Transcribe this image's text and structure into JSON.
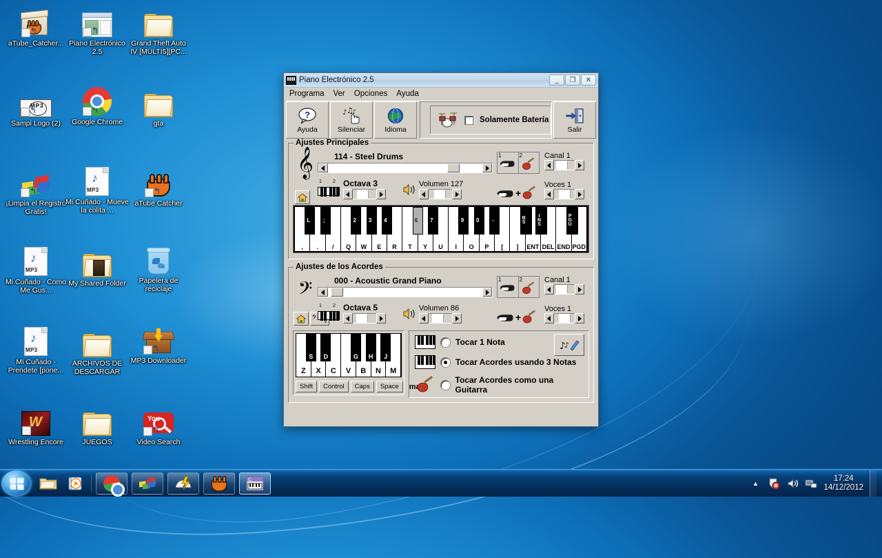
{
  "desktop": {
    "icons": [
      {
        "label": "aTube_Catcher...",
        "type": "installer",
        "shortcut": true
      },
      {
        "label": "Piano Electrónico 2.5",
        "type": "window",
        "shortcut": true
      },
      {
        "label": "Grand Theft Auto IV [MULTI5][PC...",
        "type": "folder",
        "shortcut": false
      },
      {
        "label": "Sampi Logo (2)",
        "type": "sampi",
        "shortcut": true
      },
      {
        "label": "Google Chrome",
        "type": "chrome",
        "shortcut": true
      },
      {
        "label": "gta",
        "type": "folder",
        "shortcut": false
      },
      {
        "label": "¡Limpia el Registro Gratis!",
        "type": "flags",
        "shortcut": true
      },
      {
        "label": "Mi Cuñado - Mueve la colita ...",
        "type": "mp3",
        "shortcut": false
      },
      {
        "label": "aTube Catcher",
        "type": "mitt",
        "shortcut": true
      },
      {
        "label": "Mi Cuñado - Como Me Gus...",
        "type": "mp3",
        "shortcut": false
      },
      {
        "label": "My Shared Folder",
        "type": "sharedfolder",
        "shortcut": false
      },
      {
        "label": "Papelera de reciclaje",
        "type": "bin",
        "shortcut": false
      },
      {
        "label": "Mi Cuñado - Prendete [pone...",
        "type": "mp3",
        "shortcut": false
      },
      {
        "label": "ARCHIVOS DE DESCARGAR",
        "type": "folder",
        "shortcut": false
      },
      {
        "label": "MP3 Downloader",
        "type": "download",
        "shortcut": true
      },
      {
        "label": "Wrestling Encore",
        "type": "wrestling",
        "shortcut": true
      },
      {
        "label": "JUEGOS",
        "type": "folder",
        "shortcut": false
      },
      {
        "label": "Video Search",
        "type": "videosearch",
        "shortcut": true
      }
    ]
  },
  "taskbar": {
    "start_label": "Start",
    "quick_launch": [
      {
        "name": "explorer",
        "label": "Windows Explorer"
      },
      {
        "name": "media-player",
        "label": "Windows Media Player"
      }
    ],
    "tasks": [
      {
        "name": "chrome",
        "label": "Google Chrome",
        "active": false
      },
      {
        "name": "windows-app",
        "label": "Windows",
        "active": false
      },
      {
        "name": "tuneup",
        "label": "TuneUp",
        "active": false
      },
      {
        "name": "atube-catcher",
        "label": "aTube Catcher",
        "active": false
      },
      {
        "name": "piano-electronico",
        "label": "Piano Electrónico 2.5",
        "active": true
      }
    ],
    "tray": {
      "show_hidden": "▲",
      "security_label": "Action Center",
      "volume_label": "Volume",
      "network_label": "Network",
      "time": "17:24",
      "date": "14/12/2012"
    }
  },
  "window": {
    "title": "Piano Electrónico 2.5",
    "buttons": {
      "minimize": "_",
      "maximize": "❐",
      "close": "✕"
    },
    "menu": [
      "Programa",
      "Ver",
      "Opciones",
      "Ayuda"
    ],
    "toolbar": {
      "help_label": "Ayuda",
      "mute_label": "Silenciar",
      "language_label": "Idioma",
      "drums_only_label": "Solamente Batería",
      "drums_only_checked": false,
      "exit_label": "Salir"
    },
    "main_settings": {
      "group_title": "Ajustes Principales",
      "instrument": "114 - Steel Drums",
      "instrument_scroll_percent": 84,
      "octave_label": "Octava 3",
      "octave_percent": 38,
      "volume_label": "Volumen 127",
      "volume_percent": 46,
      "channel_label": "Canal 1",
      "channel_percent": 22,
      "voices_label": "Voces 1",
      "voices_percent": 50,
      "tab1": "1",
      "tab2": "2"
    },
    "main_keyboard": {
      "white_keys": [
        ",",
        ".",
        "/",
        "Q",
        "W",
        "E",
        "R",
        "T",
        "Y",
        "U",
        "I",
        "O",
        "P",
        "[",
        "]",
        "ENT",
        "DEL",
        "END",
        "PGD"
      ],
      "black_keys": [
        {
          "label": "L",
          "after": 0,
          "pressed": false
        },
        {
          "label": ";",
          "after": 1,
          "pressed": false
        },
        {
          "label": "2",
          "after": 3,
          "pressed": false
        },
        {
          "label": "3",
          "after": 4,
          "pressed": false
        },
        {
          "label": "4",
          "after": 5,
          "pressed": false
        },
        {
          "label": "6",
          "after": 7,
          "pressed": true
        },
        {
          "label": "7",
          "after": 8,
          "pressed": false
        },
        {
          "label": "9",
          "after": 10,
          "pressed": false
        },
        {
          "label": "0",
          "after": 11,
          "pressed": false
        },
        {
          "label": "-",
          "after": 12,
          "pressed": false
        },
        {
          "label": "BS",
          "after": 14,
          "pressed": false
        },
        {
          "label": "INS",
          "after": 15,
          "pressed": false
        },
        {
          "label": "PGU",
          "after": 17,
          "pressed": false
        }
      ]
    },
    "chord_settings": {
      "group_title": "Ajustes de los Acordes",
      "instrument": "000 - Acoustic Grand Piano",
      "instrument_scroll_percent": 2,
      "octave_label": "Octava 5",
      "octave_percent": 30,
      "volume_label": "Volumen 86",
      "volume_percent": 30,
      "channel_label": "Canal 1",
      "channel_percent": 22,
      "voices_label": "Voces 1",
      "voices_percent": 50,
      "tab1": "1",
      "tab2": "2"
    },
    "chord_keyboard": {
      "white_keys": [
        "Z",
        "X",
        "C",
        "V",
        "B",
        "N",
        "M"
      ],
      "black_keys": [
        {
          "label": "S",
          "after": 0
        },
        {
          "label": "D",
          "after": 1
        },
        {
          "label": "G",
          "after": 3
        },
        {
          "label": "H",
          "after": 4
        },
        {
          "label": "J",
          "after": 5
        }
      ],
      "modifiers": [
        "Shift",
        "Control",
        "Caps",
        "Space"
      ],
      "chord_type": "maj"
    },
    "play_modes": {
      "options": [
        {
          "label": "Tocar 1 Nota",
          "selected": false,
          "icon": "keyboard-icon"
        },
        {
          "label": "Tocar Acordes usando 3 Notas",
          "selected": true,
          "icon": "keyboard-icon"
        },
        {
          "label": "Tocar Acordes como una Guitarra",
          "selected": false,
          "icon": "guitar-icon"
        }
      ],
      "edit_button_label": "Editar notas"
    }
  },
  "colors": {
    "window_face": "#d4d0c8",
    "title_gradient_top": "#d3e4f3",
    "desktop_blue": "#1f8fd4",
    "taskbar_dark": "#052f5c",
    "key_white": "#ffffff",
    "key_black": "#000000",
    "key_pressed": "#b0b0b0"
  }
}
